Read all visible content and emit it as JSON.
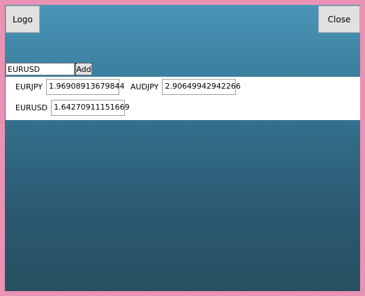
{
  "toolbar": {
    "logo_label": "Logo",
    "close_label": "Close"
  },
  "add_form": {
    "symbol_value": "EURUSD",
    "add_label": "Add"
  },
  "quotes": [
    {
      "symbol": "EURJPY",
      "value": "1.96908913679844"
    },
    {
      "symbol": "AUDJPY",
      "value": "2.90649942942266"
    },
    {
      "symbol": "EURUSD",
      "value": "1.64270911151669"
    }
  ],
  "colors": {
    "window_border": "#e992b3",
    "background_top": "#4a95b7",
    "background_bottom": "#27505f",
    "panel": "#ffffff",
    "button": "#e1e1e1"
  }
}
